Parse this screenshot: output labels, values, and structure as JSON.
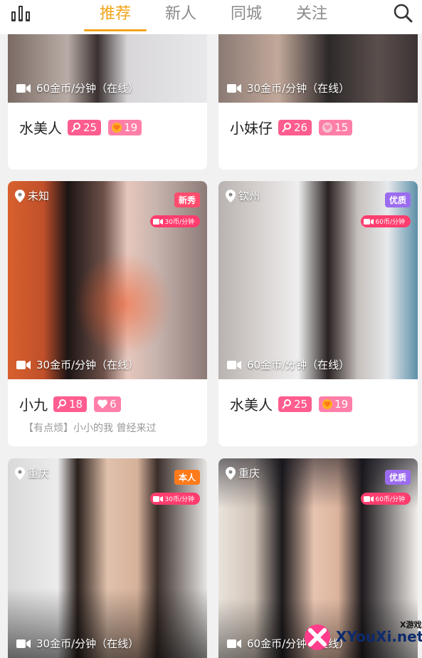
{
  "header": {
    "tabs": [
      {
        "label": "推荐",
        "active": true
      },
      {
        "label": "新人",
        "active": false
      },
      {
        "label": "同城",
        "active": false
      },
      {
        "label": "关注",
        "active": false
      }
    ],
    "accent_color": "#f2a51a"
  },
  "cards": [
    {
      "price": "60金币/分钟（在线）",
      "name": "水美人",
      "rank": "25",
      "gift": "19"
    },
    {
      "price": "30金币/分钟（在线）",
      "name": "小妹仔",
      "rank": "26",
      "gift": "15"
    },
    {
      "location": "未知",
      "tag": "新秀",
      "rate": "30币/分钟",
      "price": "30金币/分钟（在线）",
      "name": "小九",
      "rank": "18",
      "gift": "6",
      "motto": "【有点烦】小小的我 曾经来过"
    },
    {
      "location": "钦州",
      "tag": "优质",
      "rate": "60币/分钟",
      "price": "60金币/分钟（在线）",
      "name": "水美人",
      "rank": "25",
      "gift": "19"
    },
    {
      "location": "重庆",
      "tag": "本人",
      "rate": "30币/分钟",
      "price": "30金币/分钟（在线）"
    },
    {
      "location": "重庆",
      "tag": "优质",
      "rate": "60币/分钟",
      "price": "60金币/分钟（在线）"
    }
  ],
  "watermark": {
    "text": "XYouXi.net",
    "small": "X游戏"
  },
  "colors": {
    "tag_new": "#ff4d6d",
    "tag_quality": "#9b6cf0",
    "tag_self": "#ff7a1a",
    "rate_badge": "#ff3d6e"
  }
}
